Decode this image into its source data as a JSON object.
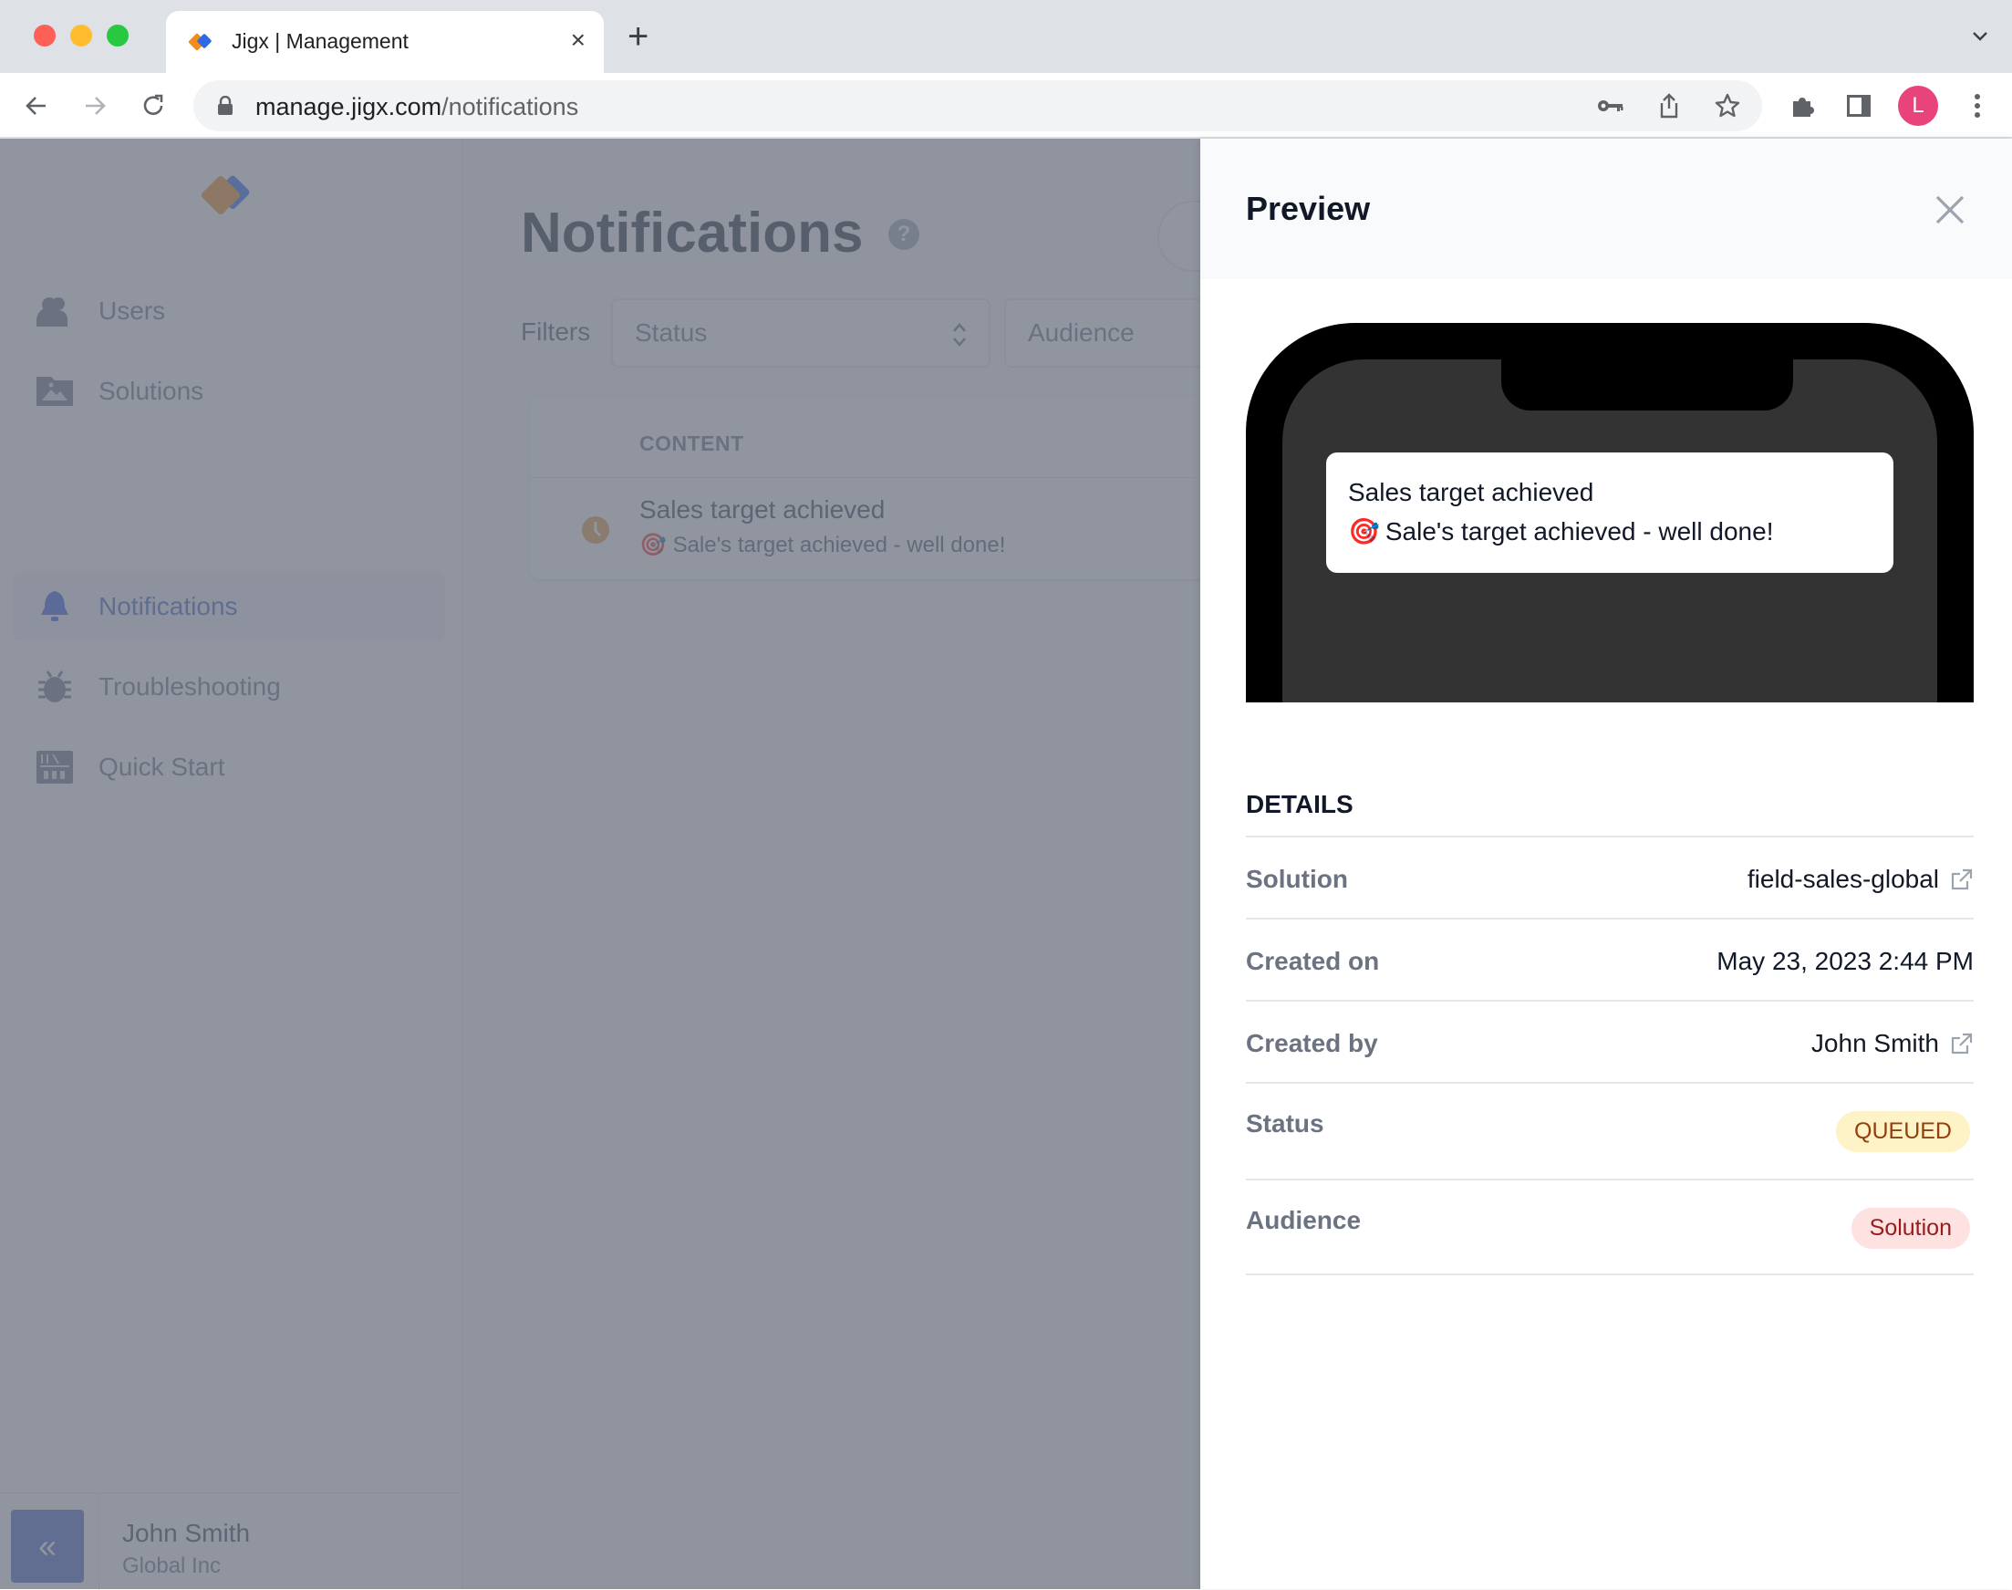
{
  "browser": {
    "tab_title": "Jigx | Management",
    "url_host": "manage.jigx.com",
    "url_path": "/notifications",
    "profile_initial": "L",
    "profile_color": "#e8437a"
  },
  "sidebar": {
    "items": [
      {
        "label": "Users",
        "icon": "users-icon",
        "active": false
      },
      {
        "label": "Solutions",
        "icon": "folder-image-icon",
        "active": false
      },
      {
        "label": "Notifications",
        "icon": "bell-icon",
        "active": true
      },
      {
        "label": "Troubleshooting",
        "icon": "bug-icon",
        "active": false
      },
      {
        "label": "Quick Start",
        "icon": "quick-start-icon",
        "active": false
      }
    ],
    "footer": {
      "collapse_icon": "«",
      "user_name": "John Smith",
      "org": "Global Inc"
    }
  },
  "main": {
    "title": "Notifications",
    "help_icon": "?",
    "filters_label": "Filters",
    "filters": [
      {
        "placeholder": "Status"
      },
      {
        "placeholder": "Audience"
      }
    ],
    "table": {
      "columns": [
        "CONTENT"
      ],
      "rows": [
        {
          "status_icon": "clock-icon",
          "title": "Sales target achieved",
          "emoji": "🎯",
          "body": "Sale's target achieved - well done!"
        }
      ]
    }
  },
  "panel": {
    "title": "Preview",
    "preview": {
      "title": "Sales target achieved",
      "emoji": "🎯",
      "body": "Sale's target achieved - well done!"
    },
    "details_heading": "DETAILS",
    "details": {
      "solution_label": "Solution",
      "solution_value": "field-sales-global",
      "created_on_label": "Created on",
      "created_on_value": "May 23, 2023 2:44 PM",
      "created_by_label": "Created by",
      "created_by_value": "John Smith",
      "status_label": "Status",
      "status_value": "QUEUED",
      "audience_label": "Audience",
      "audience_value": "Solution"
    },
    "colors": {
      "queued_bg": "#fef3c7",
      "queued_text": "#92400e",
      "audience_bg": "#fee2e2",
      "audience_text": "#991b1b",
      "accent": "#3b5fc0"
    }
  }
}
